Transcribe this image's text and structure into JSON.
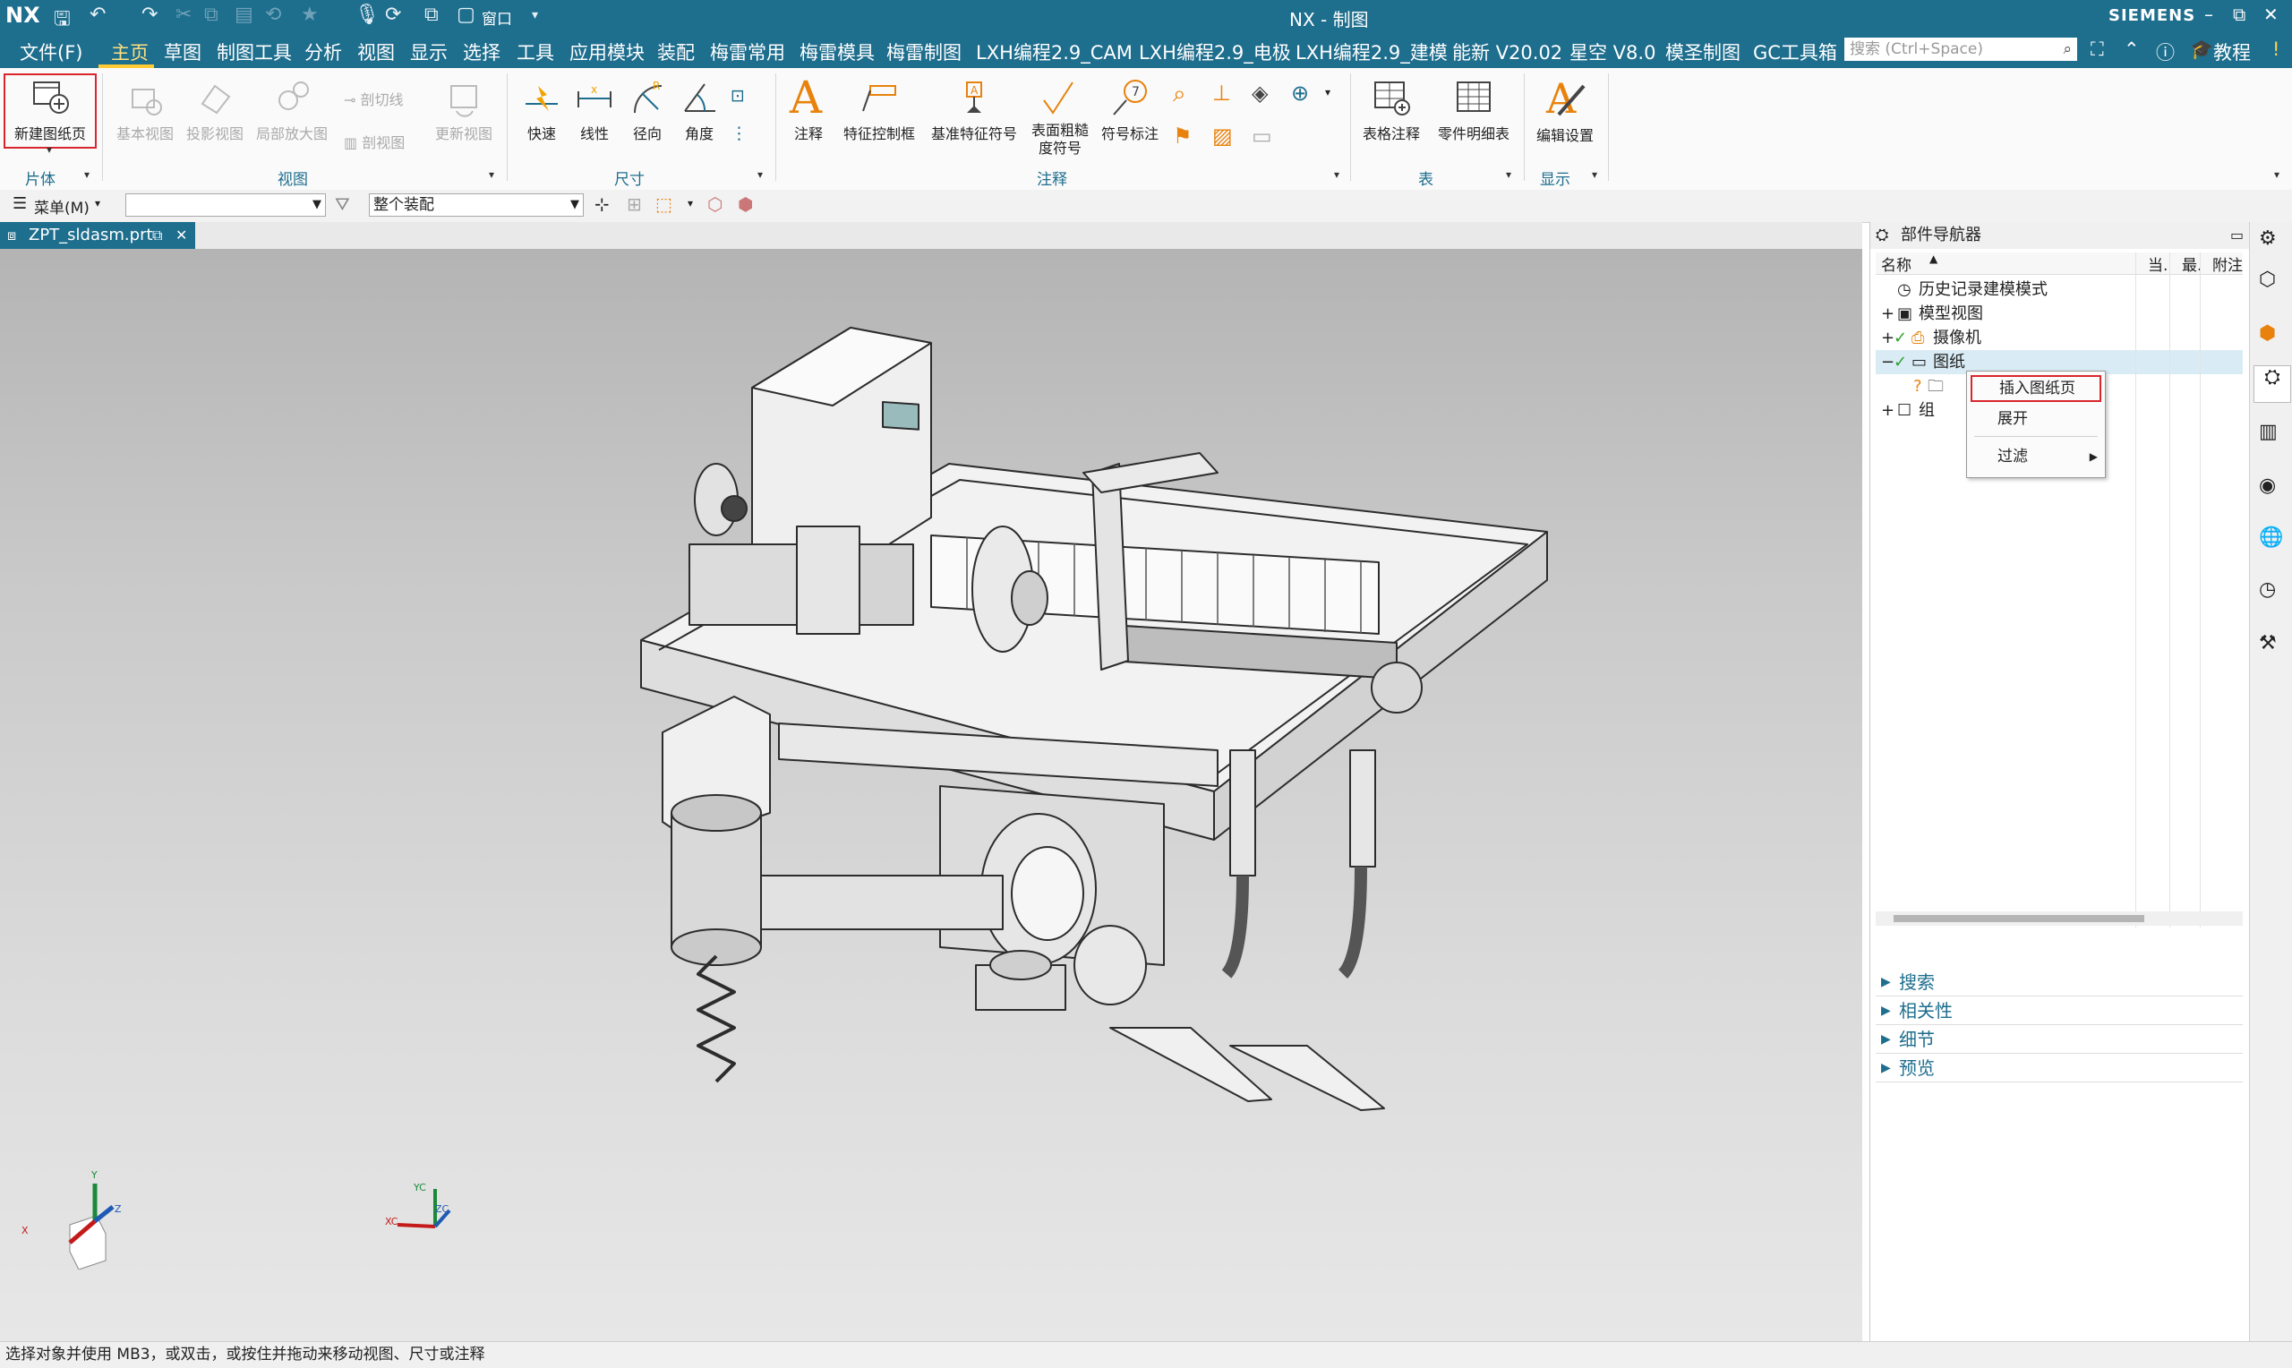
{
  "titlebar": {
    "app": "NX",
    "window_title": "NX - 制图",
    "brand": "SIEMENS",
    "window_menu": "窗口",
    "controls": [
      "–",
      "⧉",
      "✕"
    ]
  },
  "menubar": {
    "file": "文件(F)",
    "items": [
      "主页",
      "草图",
      "制图工具",
      "分析",
      "视图",
      "显示",
      "选择",
      "工具",
      "应用模块",
      "装配",
      "梅雷常用",
      "梅雷模具",
      "梅雷制图",
      "LXH编程2.9_CAM",
      "LXH编程2.9_电极",
      "LXH编程2.9_建模",
      "能新 V20.02",
      "星空 V8.0",
      "模圣制图",
      "GC工具箱"
    ],
    "search_placeholder": "搜索 (Ctrl+Space)",
    "tutorial": "教程"
  },
  "ribbon": {
    "groups": [
      {
        "label": "片体",
        "buttons": [
          "新建图纸页"
        ]
      },
      {
        "label": "视图",
        "buttons": [
          "基本视图",
          "投影视图",
          "局部放大图",
          "剖切线",
          "剖视图",
          "更新视图"
        ]
      },
      {
        "label": "尺寸",
        "buttons": [
          "快速",
          "线性",
          "径向",
          "角度"
        ]
      },
      {
        "label": "注释",
        "buttons": [
          "注释",
          "特征控制框",
          "基准特征符号",
          "表面粗糙度符号",
          "符号标注"
        ]
      },
      {
        "label": "表",
        "buttons": [
          "表格注释",
          "零件明细表"
        ]
      },
      {
        "label": "显示",
        "buttons": [
          "编辑设置"
        ]
      }
    ]
  },
  "toolbar2": {
    "menu": "菜单(M)",
    "filter_value": "",
    "scope_value": "整个装配"
  },
  "tab": {
    "filename": "ZPT_sldasm.prt"
  },
  "navigator": {
    "title": "部件导航器",
    "columns": [
      "名称",
      "当.",
      "最.",
      "附注"
    ],
    "tree": [
      {
        "label": "历史记录建模模式"
      },
      {
        "label": "模型视图"
      },
      {
        "label": "摄像机"
      },
      {
        "label": "图纸"
      },
      {
        "label": ""
      },
      {
        "label": "组"
      }
    ],
    "context_menu": [
      "插入图纸页",
      "展开",
      "过滤"
    ],
    "sections": [
      "搜索",
      "相关性",
      "细节",
      "预览"
    ]
  },
  "triad": {
    "x": "X",
    "y": "Y",
    "z": "Z",
    "xc": "XC",
    "yc": "YC",
    "zc": "ZC"
  },
  "status": {
    "message": "选择对象并使用 MB3，或双击，或按住并拖动来移动视图、尺寸或注释"
  },
  "colors": {
    "accent": "#1e6e8e",
    "highlight_box": "#d9262c",
    "selection": "#d9ecf5"
  }
}
